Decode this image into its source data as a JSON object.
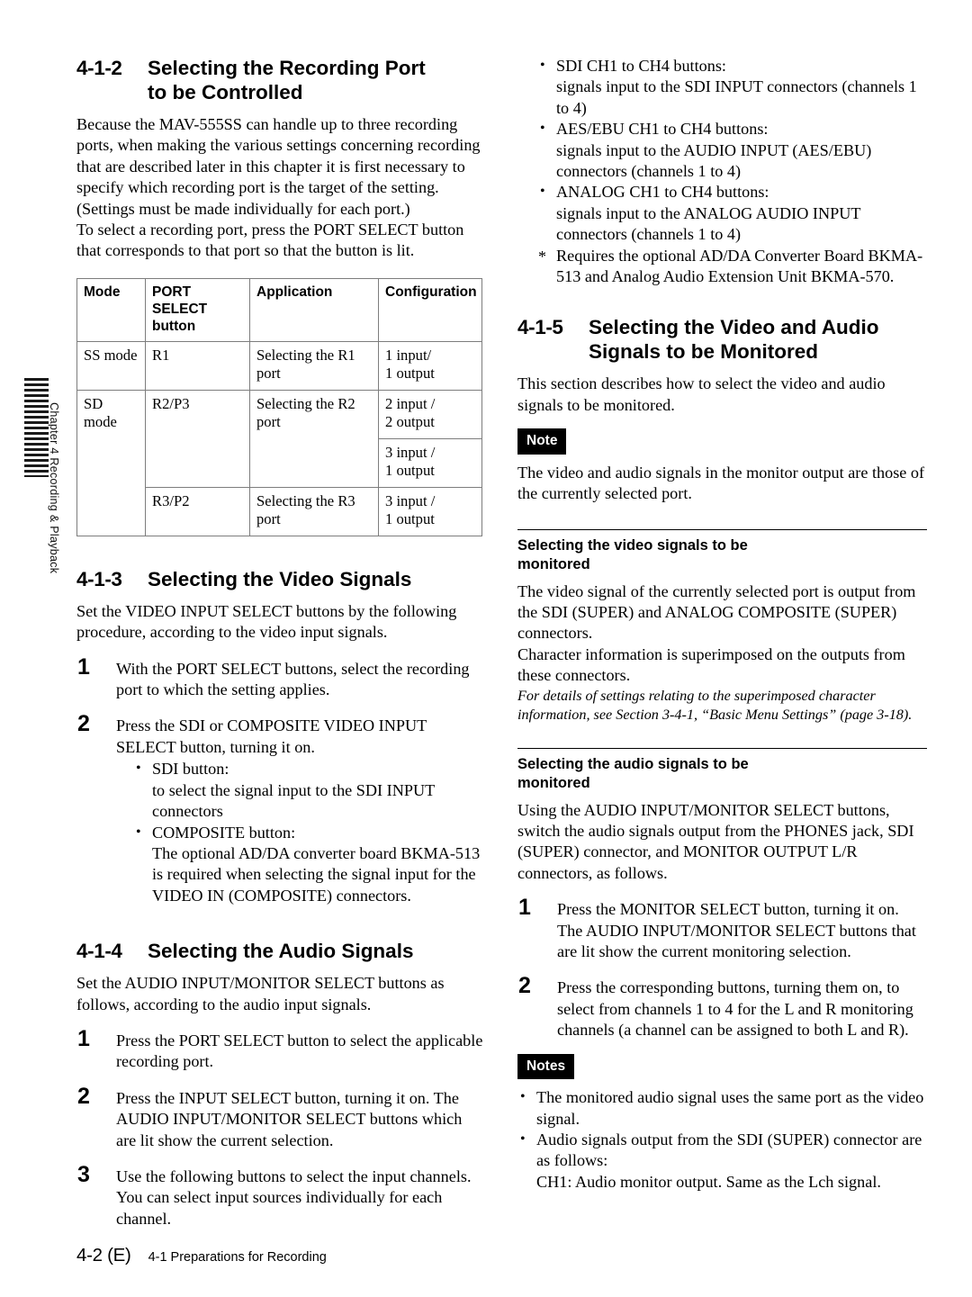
{
  "margin": {
    "chapter_label": "Chapter 4   Recording & Playback"
  },
  "footer": {
    "page_number": "4-2 (E)",
    "section_text": "4-1 Preparations for Recording"
  },
  "left_column": {
    "section_412": {
      "number": "4-1-2",
      "title_line1": "Selecting the Recording Port",
      "title_line2": "to be Controlled",
      "para1": "Because the MAV-555SS can handle up to three recording ports, when making the various settings concerning recording that are described later in this chapter it is first necessary to specify which recording port is the target of the setting.  (Settings must be made individually for each port.)",
      "para2": "To select a recording port, press the PORT SELECT button that corresponds to that port so that the button is lit."
    },
    "port_table": {
      "headers": [
        "Mode",
        "PORT SELECT\nbutton",
        "Application",
        "Configuration"
      ],
      "header_mode": "Mode",
      "header_port_select_line1": "PORT SELECT",
      "header_port_select_line2": "button",
      "header_application": "Application",
      "header_configuration": "Configuration",
      "rows": [
        {
          "mode": "SS mode",
          "button": "R1",
          "application": "Selecting the R1 port",
          "config_line1": "1 input/",
          "config_line2": "1 output"
        },
        {
          "mode": "SD mode",
          "button": "R2/P3",
          "application": "Selecting the R2 port",
          "config_line1": "2 input /",
          "config_line2": "2 output"
        },
        {
          "mode": "",
          "button": "",
          "application": "",
          "config_line1": "3 input /",
          "config_line2": "1 output"
        },
        {
          "mode": "",
          "button": "R3/P2",
          "application": "Selecting the R3 port",
          "config_line1": "3 input /",
          "config_line2": "1 output"
        }
      ]
    },
    "section_413": {
      "number": "4-1-3",
      "title": "Selecting the Video Signals",
      "intro": "Set the VIDEO INPUT SELECT buttons by the following procedure, according to the video input signals.",
      "steps": [
        {
          "num": "1",
          "text": "With the PORT SELECT buttons, select the recording port to which the setting applies."
        },
        {
          "num": "2",
          "text": "Press the SDI or COMPOSITE VIDEO INPUT SELECT button, turning it on."
        }
      ],
      "step2_bullets": [
        {
          "lead": "SDI button:",
          "body": "to select the signal input to the SDI INPUT connectors"
        },
        {
          "lead": "COMPOSITE button:",
          "body": "The optional AD/DA converter board BKMA-513 is required when selecting the signal input for the VIDEO IN (COMPOSITE) connectors."
        }
      ]
    },
    "section_414": {
      "number": "4-1-4",
      "title": "Selecting the Audio Signals",
      "intro": "Set the AUDIO INPUT/MONITOR SELECT buttons as follows, according to the audio input signals.",
      "steps": [
        {
          "num": "1",
          "text": "Press the PORT SELECT button to select the applicable recording port."
        },
        {
          "num": "2",
          "text": "Press the INPUT SELECT button, turning it on. The AUDIO INPUT/MONITOR SELECT buttons which are lit show the current selection."
        },
        {
          "num": "3",
          "text": "Use the following buttons to select the input channels. You can select input sources individually for each channel."
        }
      ]
    }
  },
  "right_column": {
    "channel_bullets": [
      {
        "marker": "•",
        "lead": "SDI CH1 to CH4 buttons:",
        "body": "signals input to the SDI INPUT connectors (channels 1 to 4)"
      },
      {
        "marker": "•",
        "lead": "AES/EBU CH1 to CH4 buttons:",
        "body": "signals input to the AUDIO INPUT (AES/EBU) connectors (channels 1 to 4)"
      },
      {
        "marker": "•",
        "lead": "ANALOG CH1 to CH4 buttons:",
        "body": "signals input to the ANALOG AUDIO INPUT connectors (channels 1 to 4)"
      }
    ],
    "footnote": {
      "marker": "*",
      "text": "Requires the optional AD/DA Converter Board BKMA-513 and Analog Audio Extension Unit BKMA-570."
    },
    "section_415": {
      "number": "4-1-5",
      "title_line1": "Selecting the Video and Audio",
      "title_line2": "Signals to be Monitored",
      "intro": "This section describes how to select the video and audio signals to be monitored.",
      "note_badge": "Note",
      "note_text": "The video and audio signals in the monitor output are those of the currently selected port."
    },
    "video_monitor": {
      "heading_line1": "Selecting the video signals to be",
      "heading_line2": "monitored",
      "para1": "The video signal of the currently selected port is output from the SDI (SUPER) and ANALOG COMPOSITE (SUPER) connectors.",
      "para2": "Character information is superimposed on the outputs from these connectors.",
      "italic_note": "For details of settings relating to the superimposed character information, see Section 3-4-1, “Basic Menu Settings” (page 3-18)."
    },
    "audio_monitor": {
      "heading_line1": "Selecting the audio signals to be",
      "heading_line2": "monitored",
      "intro": "Using the AUDIO INPUT/MONITOR SELECT buttons, switch the audio signals output from the PHONES jack, SDI (SUPER) connector, and MONITOR OUTPUT L/R connectors, as follows.",
      "steps": [
        {
          "num": "1",
          "text": "Press the MONITOR SELECT button, turning it on. The AUDIO INPUT/MONITOR SELECT buttons that are lit show the current monitoring selection."
        },
        {
          "num": "2",
          "text": "Press the corresponding buttons, turning them on, to select from channels 1 to 4 for the L and R monitoring channels (a channel can be assigned to both L and R)."
        }
      ],
      "notes_badge": "Notes",
      "notes": [
        {
          "marker": "•",
          "text": "The monitored audio signal uses the same port as the video signal."
        },
        {
          "marker": "•",
          "text": "Audio signals output from the SDI (SUPER) connector are as follows:"
        }
      ],
      "notes_trailing": "CH1: Audio monitor output.  Same as the Lch signal."
    }
  }
}
